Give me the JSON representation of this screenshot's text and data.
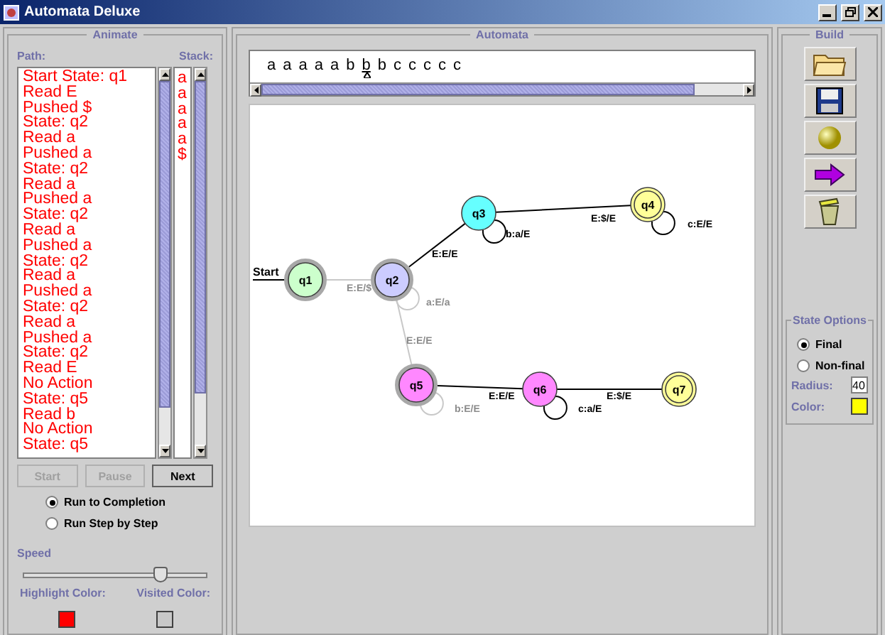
{
  "window": {
    "title": "Automata Deluxe"
  },
  "animate": {
    "title": "Animate",
    "path_label": "Path:",
    "stack_label": "Stack:",
    "path": [
      "Start State: q1",
      "Read E",
      "Pushed $",
      "State: q2",
      "Read a",
      "Pushed a",
      "State: q2",
      "Read a",
      "Pushed a",
      "State: q2",
      "Read a",
      "Pushed a",
      "State: q2",
      "Read a",
      "Pushed a",
      "State: q2",
      "Read a",
      "Pushed a",
      "State: q2",
      "Read E",
      "No Action",
      "State: q5",
      "Read b",
      "No Action",
      "State: q5"
    ],
    "stack": [
      "a",
      "a",
      "a",
      "a",
      "a",
      "$"
    ],
    "buttons": [
      {
        "label": "Start",
        "disabled": true
      },
      {
        "label": "Pause",
        "disabled": true
      },
      {
        "label": "Next",
        "disabled": false
      }
    ],
    "run_modes": [
      {
        "label": "Run to Completion",
        "selected": true
      },
      {
        "label": "Run Step by Step",
        "selected": false
      }
    ],
    "speed": {
      "label": "Speed",
      "level": 0.75
    },
    "highlight_color": {
      "label": "Highlight Color:",
      "color": "#ff0000"
    },
    "visited_color": {
      "label": "Visited Color:",
      "color": "#c8c8c8"
    }
  },
  "automata": {
    "title": "Automata",
    "tape": [
      {
        "symbol": "a",
        "selected": false
      },
      {
        "symbol": "a",
        "selected": false
      },
      {
        "symbol": "a",
        "selected": false
      },
      {
        "symbol": "a",
        "selected": false
      },
      {
        "symbol": "a",
        "selected": false
      },
      {
        "symbol": "b",
        "selected": false
      },
      {
        "symbol": "b",
        "selected": true
      },
      {
        "symbol": "b",
        "selected": false
      },
      {
        "symbol": "c",
        "selected": false
      },
      {
        "symbol": "c",
        "selected": false
      },
      {
        "symbol": "c",
        "selected": false
      },
      {
        "symbol": "c",
        "selected": false
      },
      {
        "symbol": "c",
        "selected": false
      }
    ],
    "start_label": "Start",
    "states": [
      {
        "name": "q1",
        "color": "#ccffcc",
        "final": false,
        "visited": true
      },
      {
        "name": "q2",
        "color": "#ccccff",
        "final": false,
        "visited": true
      },
      {
        "name": "q3",
        "color": "#66ffff",
        "final": false,
        "visited": false
      },
      {
        "name": "q4",
        "color": "#ffff99",
        "final": true,
        "visited": false
      },
      {
        "name": "q5",
        "color": "#ff88ff",
        "final": false,
        "visited": true
      },
      {
        "name": "q6",
        "color": "#ff88ff",
        "final": false,
        "visited": false
      },
      {
        "name": "q7",
        "color": "#ffff99",
        "final": true,
        "visited": false
      }
    ],
    "transitions": [
      {
        "kind": "edge",
        "label": "E:E/$",
        "visited": true
      },
      {
        "kind": "loop",
        "label": "a:E/a",
        "visited": true
      },
      {
        "kind": "edge",
        "label": "E:E/E",
        "visited": false
      },
      {
        "kind": "loop",
        "label": "b:a/E",
        "visited": false
      },
      {
        "kind": "edge",
        "label": "E:$/E",
        "visited": false
      },
      {
        "kind": "loop",
        "label": "c:E/E",
        "visited": false
      },
      {
        "kind": "edge",
        "label": "E:E/E",
        "visited": true
      },
      {
        "kind": "loop",
        "label": "b:E/E",
        "visited": true
      },
      {
        "kind": "edge",
        "label": "E:E/E",
        "visited": false
      },
      {
        "kind": "loop",
        "label": "c:a/E",
        "visited": false
      },
      {
        "kind": "edge",
        "label": "E:$/E",
        "visited": false
      }
    ]
  },
  "build": {
    "title": "Build",
    "tools": [
      {
        "kind": "folder"
      },
      {
        "kind": "floppy"
      },
      {
        "kind": "sphere"
      },
      {
        "kind": "arrow"
      },
      {
        "kind": "trash"
      }
    ],
    "state_options": {
      "title": "State Options",
      "types": [
        {
          "label": "Final",
          "selected": true
        },
        {
          "label": "Non-final",
          "selected": false
        }
      ],
      "radius_label": "Radius:",
      "radius": "40",
      "color_label": "Color:",
      "color": "#ffff00"
    }
  }
}
